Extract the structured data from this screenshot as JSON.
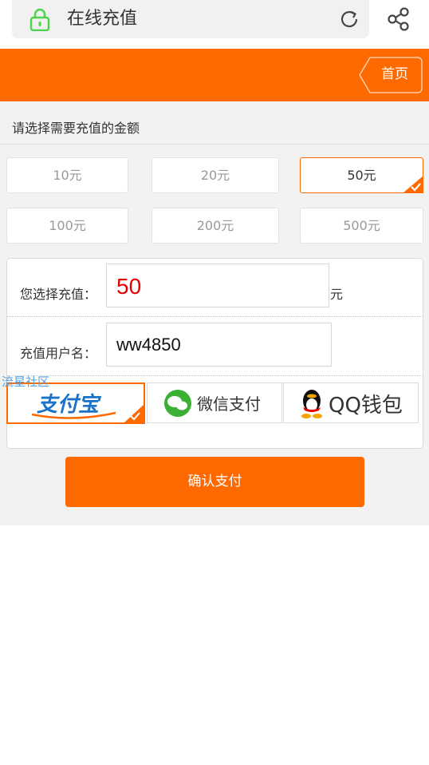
{
  "browser": {
    "title": "在线充值",
    "lock_icon": "lock-icon",
    "refresh_icon": "refresh-icon",
    "share_icon": "share-icon"
  },
  "header": {
    "home_label": "首页",
    "color": "#ff6a00"
  },
  "recharge": {
    "section_title": "请选择需要充值的金额",
    "amounts": [
      "10元",
      "20元",
      "50元",
      "100元",
      "200元",
      "500元"
    ],
    "selected_amount": "50元"
  },
  "form": {
    "amount_label": "您选择充值：",
    "amount_value": "50",
    "amount_unit": "元",
    "username_label": "充值用户名：",
    "username_value": "ww4850"
  },
  "watermark": "流星社区",
  "payment": {
    "methods": [
      {
        "id": "alipay",
        "label": "支付宝",
        "selected": true
      },
      {
        "id": "wechat",
        "label": "微信支付",
        "selected": false
      },
      {
        "id": "qq",
        "label": "QQ钱包",
        "selected": false
      }
    ]
  },
  "confirm_label": "确认支付",
  "colors": {
    "accent": "#ff6a00",
    "amount_red": "#e60000",
    "wechat_green": "#3cb034",
    "alipay_blue": "#1a73c7"
  }
}
